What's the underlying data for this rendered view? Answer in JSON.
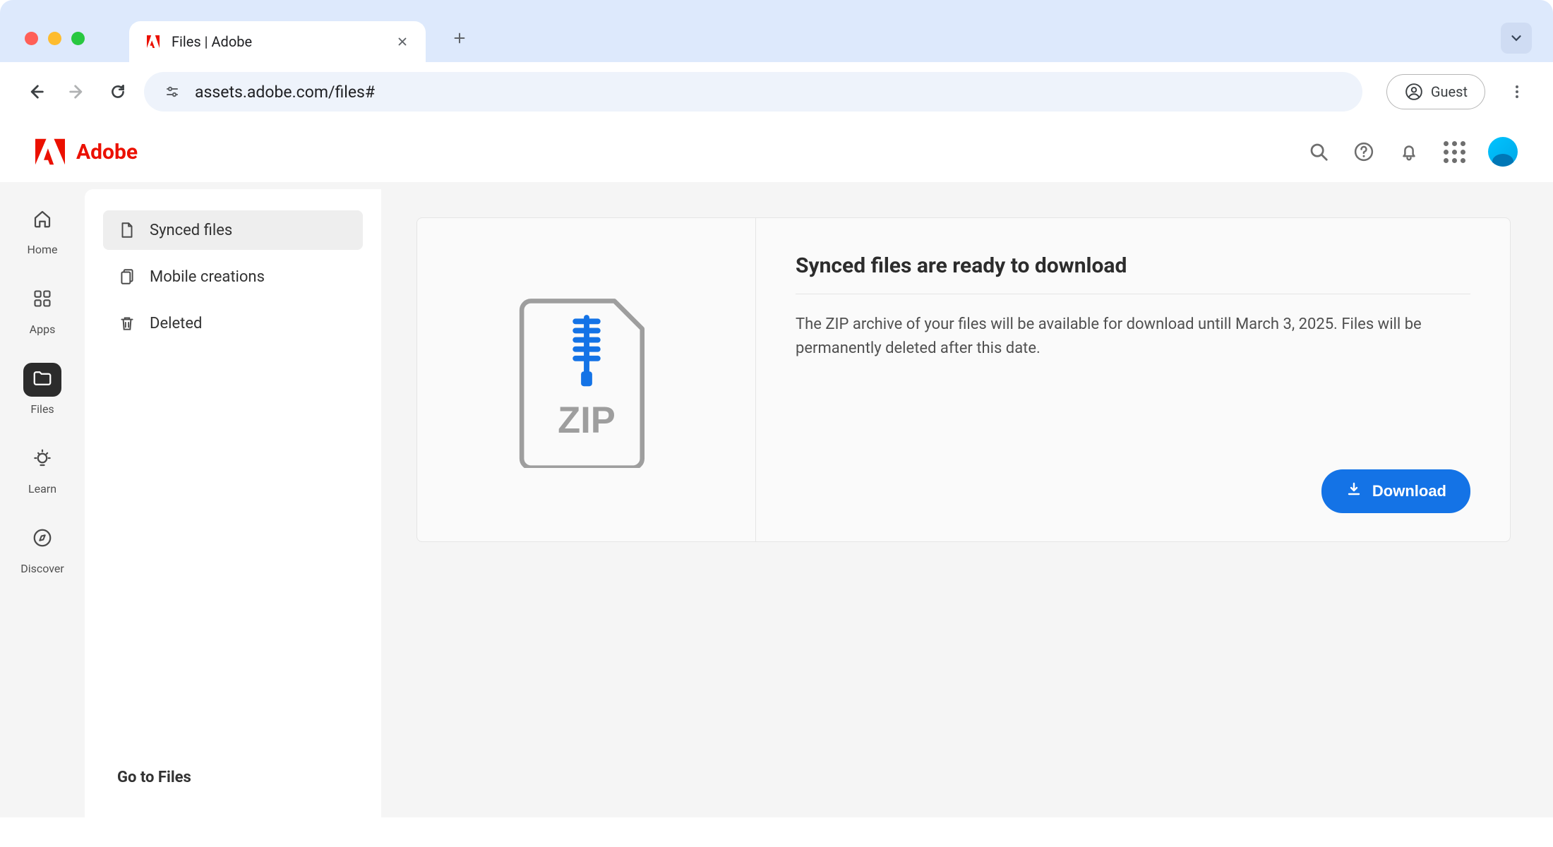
{
  "browser": {
    "tab_title": "Files | Adobe",
    "url": "assets.adobe.com/files#",
    "guest_label": "Guest"
  },
  "brand": {
    "name": "Adobe"
  },
  "rail": {
    "items": [
      {
        "label": "Home"
      },
      {
        "label": "Apps"
      },
      {
        "label": "Files"
      },
      {
        "label": "Learn"
      },
      {
        "label": "Discover"
      }
    ]
  },
  "side_panel": {
    "items": [
      {
        "label": "Synced files"
      },
      {
        "label": "Mobile creations"
      },
      {
        "label": "Deleted"
      }
    ],
    "footer_link": "Go to Files"
  },
  "card": {
    "zip_label": "ZIP",
    "title": "Synced files are ready to download",
    "body": "The ZIP archive of your files will be available for download untill March 3, 2025. Files will be permanently deleted after this date.",
    "download_label": "Download"
  }
}
